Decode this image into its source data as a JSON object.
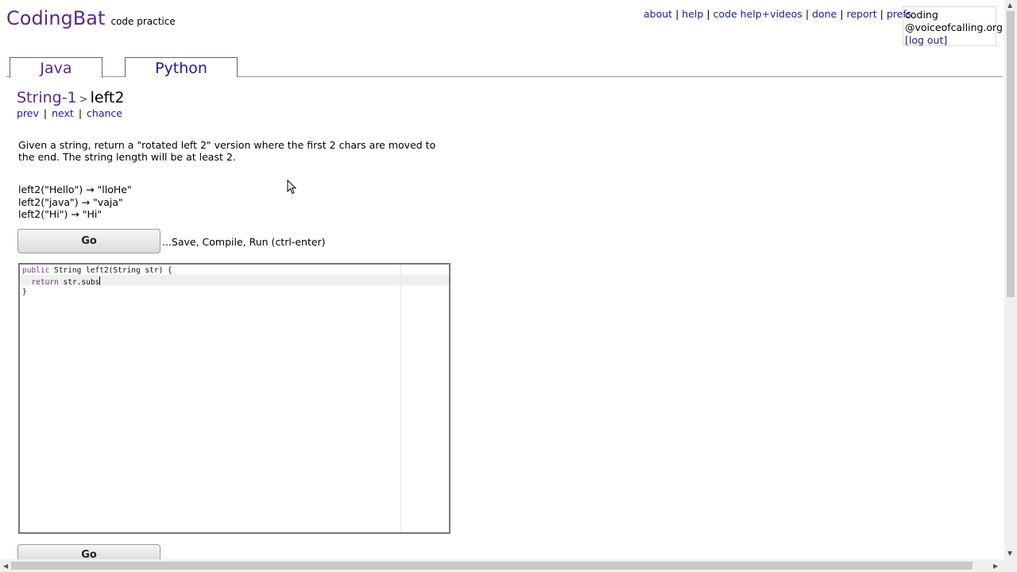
{
  "header": {
    "logo": "CodingBat",
    "tagline": "code practice",
    "nav": [
      "about",
      "help",
      "code help+videos",
      "done",
      "report",
      "prefs"
    ],
    "user_line1": "coding",
    "user_line2": "@voiceofcalling.org",
    "logout": "[log out]"
  },
  "tabs": [
    {
      "label": "Java",
      "active": true
    },
    {
      "label": "Python",
      "active": false
    }
  ],
  "breadcrumb": {
    "parent": "String-1",
    "separator": ">",
    "current": "left2"
  },
  "problem_nav": {
    "prev": "prev",
    "next": "next",
    "chance": "chance"
  },
  "problem": {
    "description": "Given a string, return a \"rotated left 2\" version where the first 2 chars are moved to the end. The string length will be at least 2.",
    "examples": [
      "left2(\"Hello\") → \"lloHe\"",
      "left2(\"java\") → \"vaja\"",
      "left2(\"Hi\") → \"Hi\""
    ]
  },
  "go_button": "Go",
  "go_hint": "...Save, Compile, Run (ctrl-enter)",
  "editor": {
    "line1_kw": "public",
    "line1_rest": " String left2(String str) {",
    "line2_kw": "return",
    "line2_rest": " str.subs",
    "line3": "}"
  },
  "colors": {
    "brand": "#5a2a87",
    "link": "#1a1aa6"
  }
}
